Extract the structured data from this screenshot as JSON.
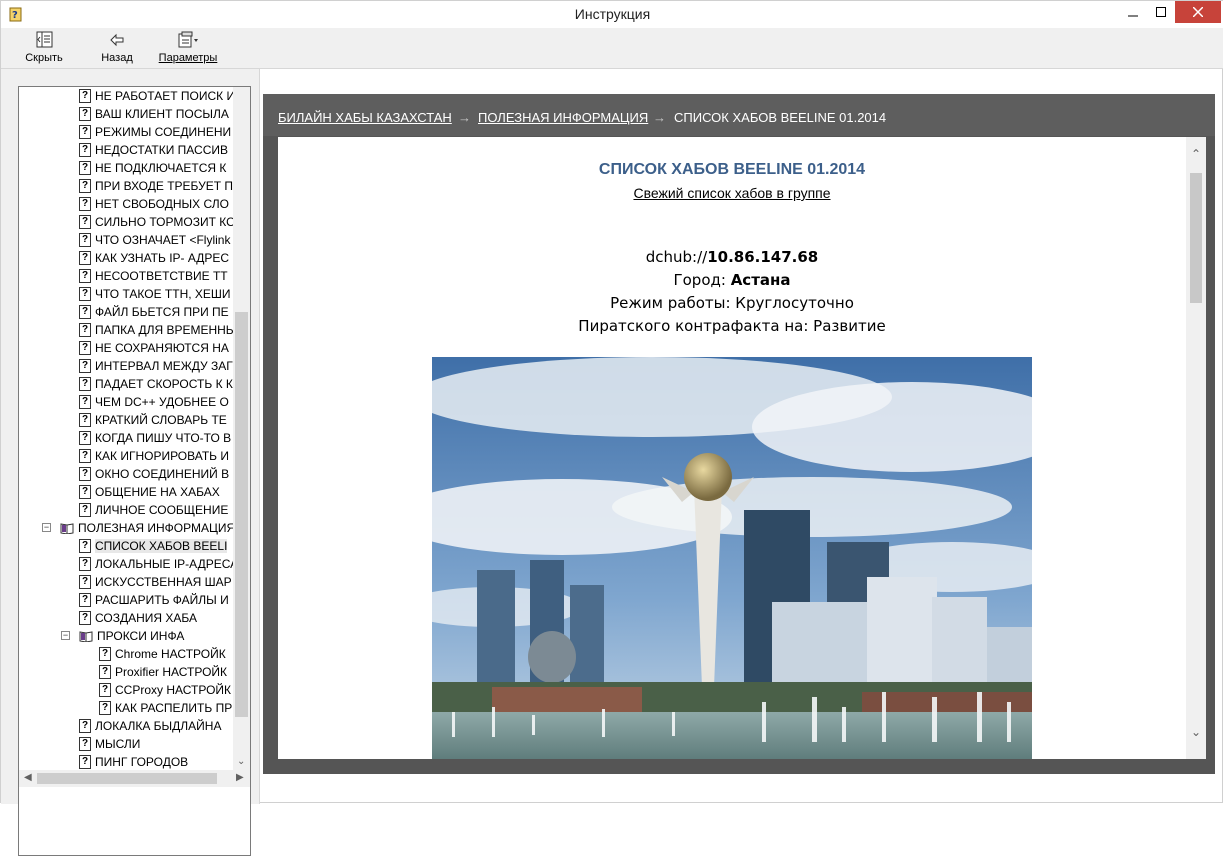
{
  "window": {
    "title": "Инструкция"
  },
  "toolbar": {
    "hide_label": "Скрыть",
    "back_label": "Назад",
    "options_label": "Параметры"
  },
  "tree": {
    "items": [
      "НЕ РАБОТАЕТ ПОИСК И",
      "ВАШ КЛИЕНТ ПОСЫЛА",
      "РЕЖИМЫ СОЕДИНЕНИ",
      "НЕДОСТАТКИ ПАССИВ",
      "НЕ ПОДКЛЮЧАЕТСЯ К",
      "ПРИ ВХОДЕ ТРЕБУЕТ П",
      "НЕТ СВОБОДНЫХ СЛО",
      "СИЛЬНО ТОРМОЗИТ КО",
      "ЧТО ОЗНАЧАЕТ <Flylink",
      "КАК УЗНАТЬ IP- АДРЕС",
      "НЕСООТВЕТСТВИЕ ТТ",
      "ЧТО ТАКОЕ ТТН, ХЕШИ",
      "ФАЙЛ БЬЕТСЯ ПРИ ПЕ",
      "ПАПКА ДЛЯ ВРЕМЕННЫ",
      "НЕ СОХРАНЯЮТСЯ НА",
      "ИНТЕРВАЛ МЕЖДУ ЗАГ",
      "ПАДАЕТ СКОРОСТЬ К К",
      "ЧЕМ DC++ УДОБНЕЕ О",
      "КРАТКИЙ СЛОВАРЬ ТЕ",
      "КОГДА ПИШУ ЧТО-ТО В",
      "КАК ИГНОРИРОВАТЬ И",
      "ОКНО СОЕДИНЕНИЙ В",
      "ОБЩЕНИЕ НА ХАБАХ",
      "ЛИЧНОЕ СООБЩЕНИЕ",
      "ПОЛЕЗНАЯ ИНФОРМАЦИЯ",
      "СПИСОК ХАБОВ BEELI",
      "ЛОКАЛЬНЫЕ IP-АДРЕСА",
      "ИСКУССТВЕННАЯ ШАР",
      "РАСШАРИТЬ ФАЙЛЫ И",
      "СОЗДАНИЯ ХАБА",
      "ПРОКСИ ИНФА",
      "Chrome  НАСТРОЙК",
      "Proxifier  НАСТРОЙК",
      "CCProxy  НАСТРОЙК",
      "КАК РАСПЕЛИТЬ ПР",
      "ЛОКАЛКА БЫДЛАЙНА",
      "МЫСЛИ",
      "ПИНГ ГОРОДОВ"
    ]
  },
  "breadcrumb": {
    "item1": "БИЛАЙН ХАБЫ КАЗАХСТАН",
    "item2": "ПОЛЕЗНАЯ ИНФОРМАЦИЯ",
    "item3": "СПИСОК ХАБОВ BEELINE 01.2014",
    "sep": "→"
  },
  "doc": {
    "title": "СПИСОК ХАБОВ BEELINE 01.2014",
    "subtitle_link": "Свежий список хабов в группе",
    "hub_prefix": "dchub://",
    "hub_address": "10.86.147.68",
    "city_label": "Город: ",
    "city": "Астана",
    "mode_line": "Режим работы: Круглосуточно",
    "piracy_line": "Пиратского контрафакта на: Развитие"
  }
}
